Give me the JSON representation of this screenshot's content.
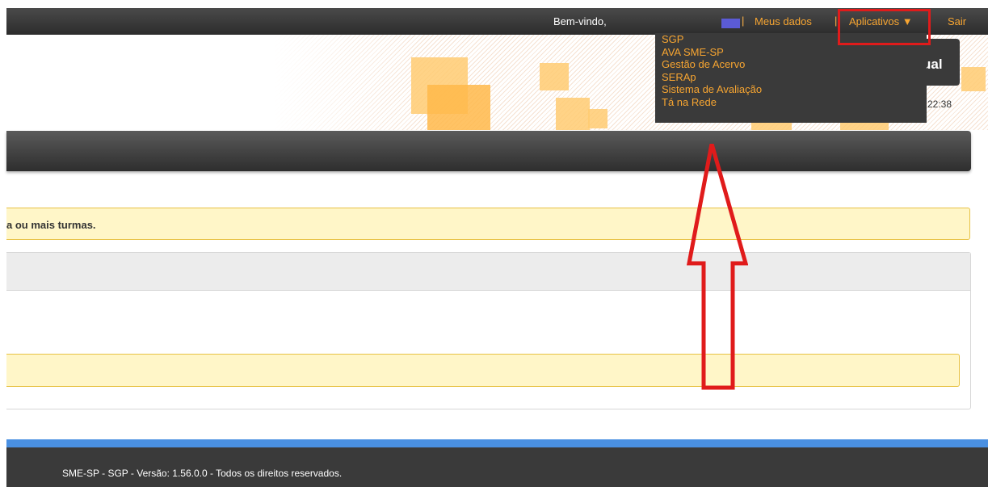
{
  "topbar": {
    "welcome": "Bem-vindo,",
    "sep1": "|",
    "my_data": "Meus dados",
    "sep2": "|",
    "apps": "Aplicativos ▼",
    "logout": "Sair"
  },
  "header": {
    "title_fragment": "ual",
    "time_fragment": "22:38"
  },
  "apps_menu": {
    "items": [
      "SGP",
      "AVA SME-SP",
      "Gestão de Acervo",
      "SERAp",
      "Sistema de Avaliação",
      "Tá na Rede"
    ]
  },
  "main": {
    "alert_text": "a ou mais turmas."
  },
  "footer": {
    "text": "SME-SP - SGP - Versão: 1.56.0.0 - Todos os direitos reservados."
  },
  "colors": {
    "accent": "#f7a531",
    "annotation": "#e01b1b",
    "footer_stripe": "#4a90e2"
  }
}
